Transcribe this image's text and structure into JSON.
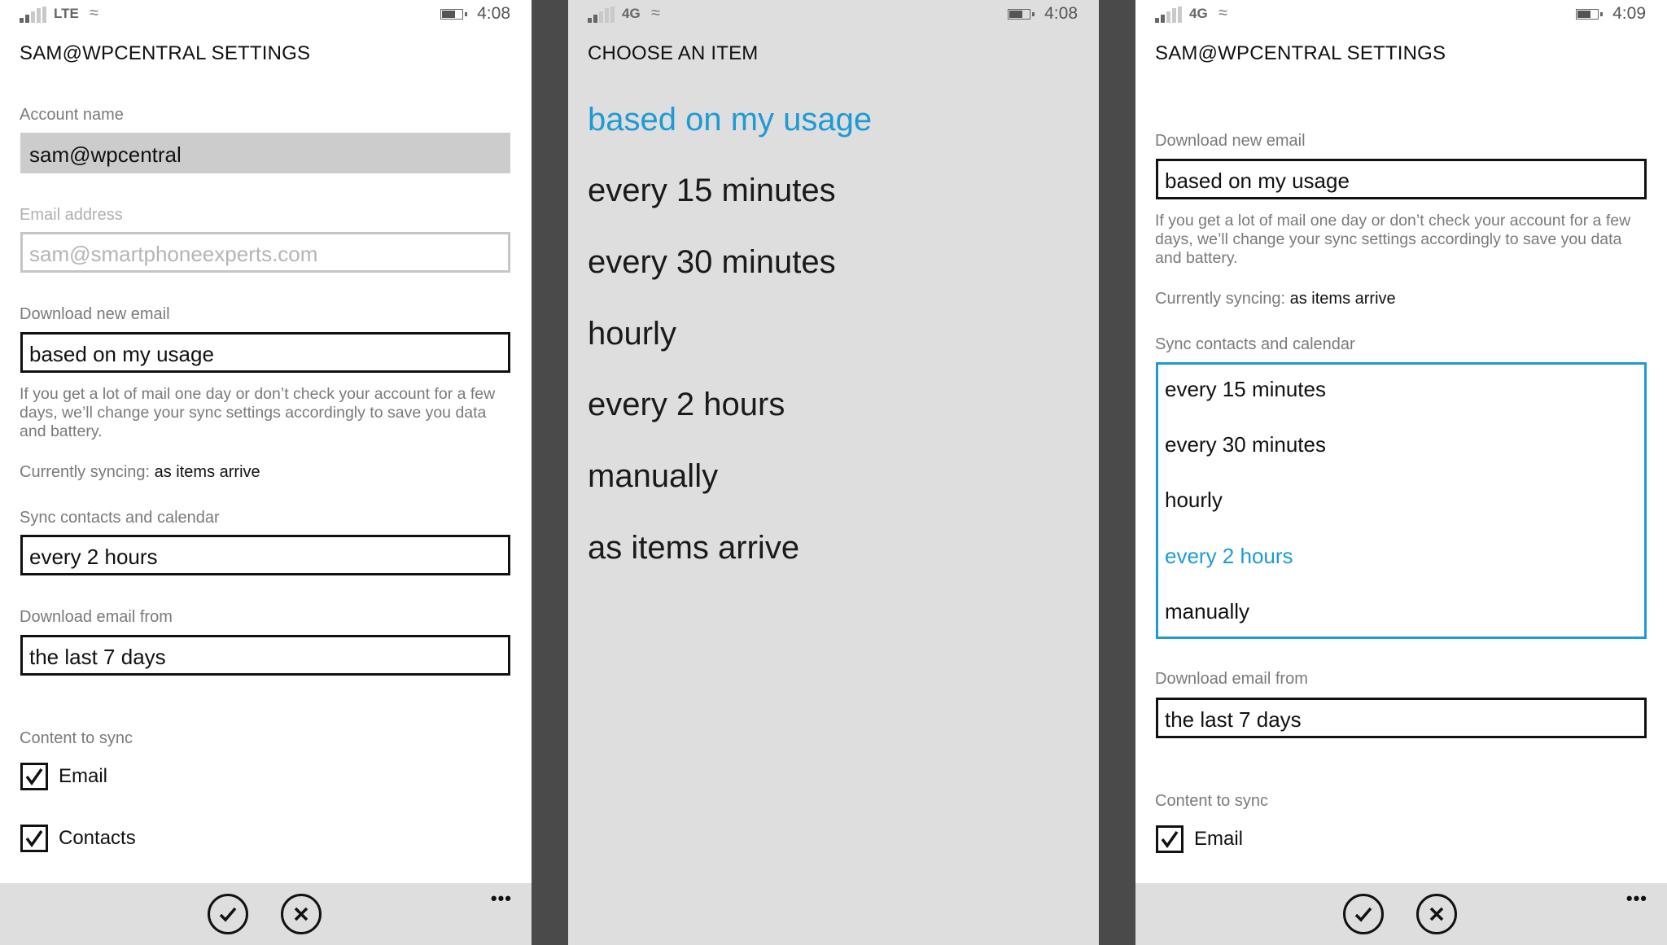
{
  "accent_color": "#1e9ad6",
  "panels": [
    {
      "status": {
        "network": "LTE",
        "time": "4:08"
      },
      "title": "SAM@WPCENTRAL SETTINGS",
      "account_name": {
        "label": "Account name",
        "value": "sam@wpcentral"
      },
      "email_address": {
        "label": "Email address",
        "value": "sam@smartphoneexperts.com"
      },
      "download_new_email": {
        "label": "Download new email",
        "value": "based on my usage"
      },
      "help_text": "If you get a lot of mail one day or don’t check your account for a few days, we’ll change your sync settings accordingly to save you data and battery.",
      "currently_syncing": {
        "label": "Currently syncing:",
        "value": "as items arrive"
      },
      "sync_contacts": {
        "label": "Sync contacts and calendar",
        "value": "every 2 hours"
      },
      "download_from": {
        "label": "Download email from",
        "value": "the last 7 days"
      },
      "content_to_sync": {
        "label": "Content to sync",
        "items": [
          {
            "label": "Email",
            "checked": true
          },
          {
            "label": "Contacts",
            "checked": true
          }
        ]
      },
      "appbar": {
        "done": "done-icon",
        "cancel": "cancel-icon",
        "more": "•••"
      }
    },
    {
      "status": {
        "network": "4G",
        "time": "4:08"
      },
      "title": "CHOOSE AN ITEM",
      "options": [
        {
          "label": "based on my usage",
          "selected": true
        },
        {
          "label": "every 15 minutes",
          "selected": false
        },
        {
          "label": "every 30 minutes",
          "selected": false
        },
        {
          "label": "hourly",
          "selected": false
        },
        {
          "label": "every 2 hours",
          "selected": false
        },
        {
          "label": "manually",
          "selected": false
        },
        {
          "label": "as items arrive",
          "selected": false
        }
      ]
    },
    {
      "status": {
        "network": "4G",
        "time": "4:09"
      },
      "title": "SAM@WPCENTRAL SETTINGS",
      "download_new_email": {
        "label": "Download new email",
        "value": "based on my usage"
      },
      "help_text": "If you get a lot of mail one day or don’t check your account for a few days, we’ll change your sync settings accordingly to save you data and battery.",
      "currently_syncing": {
        "label": "Currently syncing:",
        "value": "as items arrive"
      },
      "sync_contacts": {
        "label": "Sync contacts and calendar",
        "options": [
          {
            "label": "every 15 minutes",
            "selected": false
          },
          {
            "label": "every 30 minutes",
            "selected": false
          },
          {
            "label": "hourly",
            "selected": false
          },
          {
            "label": "every 2 hours",
            "selected": true
          },
          {
            "label": "manually",
            "selected": false
          }
        ]
      },
      "download_from": {
        "label": "Download email from",
        "value": "the last 7 days"
      },
      "content_to_sync": {
        "label": "Content to sync",
        "items": [
          {
            "label": "Email",
            "checked": true
          }
        ]
      },
      "appbar": {
        "done": "done-icon",
        "cancel": "cancel-icon",
        "more": "•••"
      }
    }
  ]
}
